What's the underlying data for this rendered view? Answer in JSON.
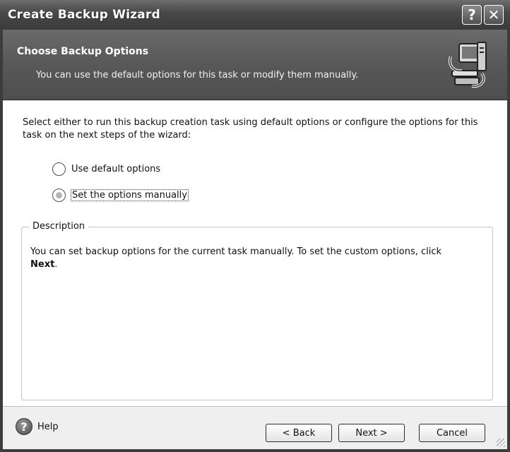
{
  "window": {
    "title": "Create Backup Wizard",
    "help_glyph": "?",
    "close_glyph": "✕"
  },
  "header": {
    "title": "Choose Backup Options",
    "subtitle": "You can use the default options for this task or modify them manually.",
    "icon": "backup-computer-icon"
  },
  "intro": {
    "text": "Select either to run this backup creation task using default options or configure the options for this task on the next steps of the wizard:"
  },
  "options": [
    {
      "label": "Use default options",
      "selected": false
    },
    {
      "label": "Set the options manually",
      "selected": true
    }
  ],
  "description": {
    "legend": "Description",
    "text": "You can set backup options for the current task manually. To set the custom options, click",
    "emphasis": "Next",
    "trailing": "."
  },
  "footer": {
    "help_label": "Help",
    "back_label": "< Back",
    "next_label": "Next >",
    "cancel_label": "Cancel"
  }
}
